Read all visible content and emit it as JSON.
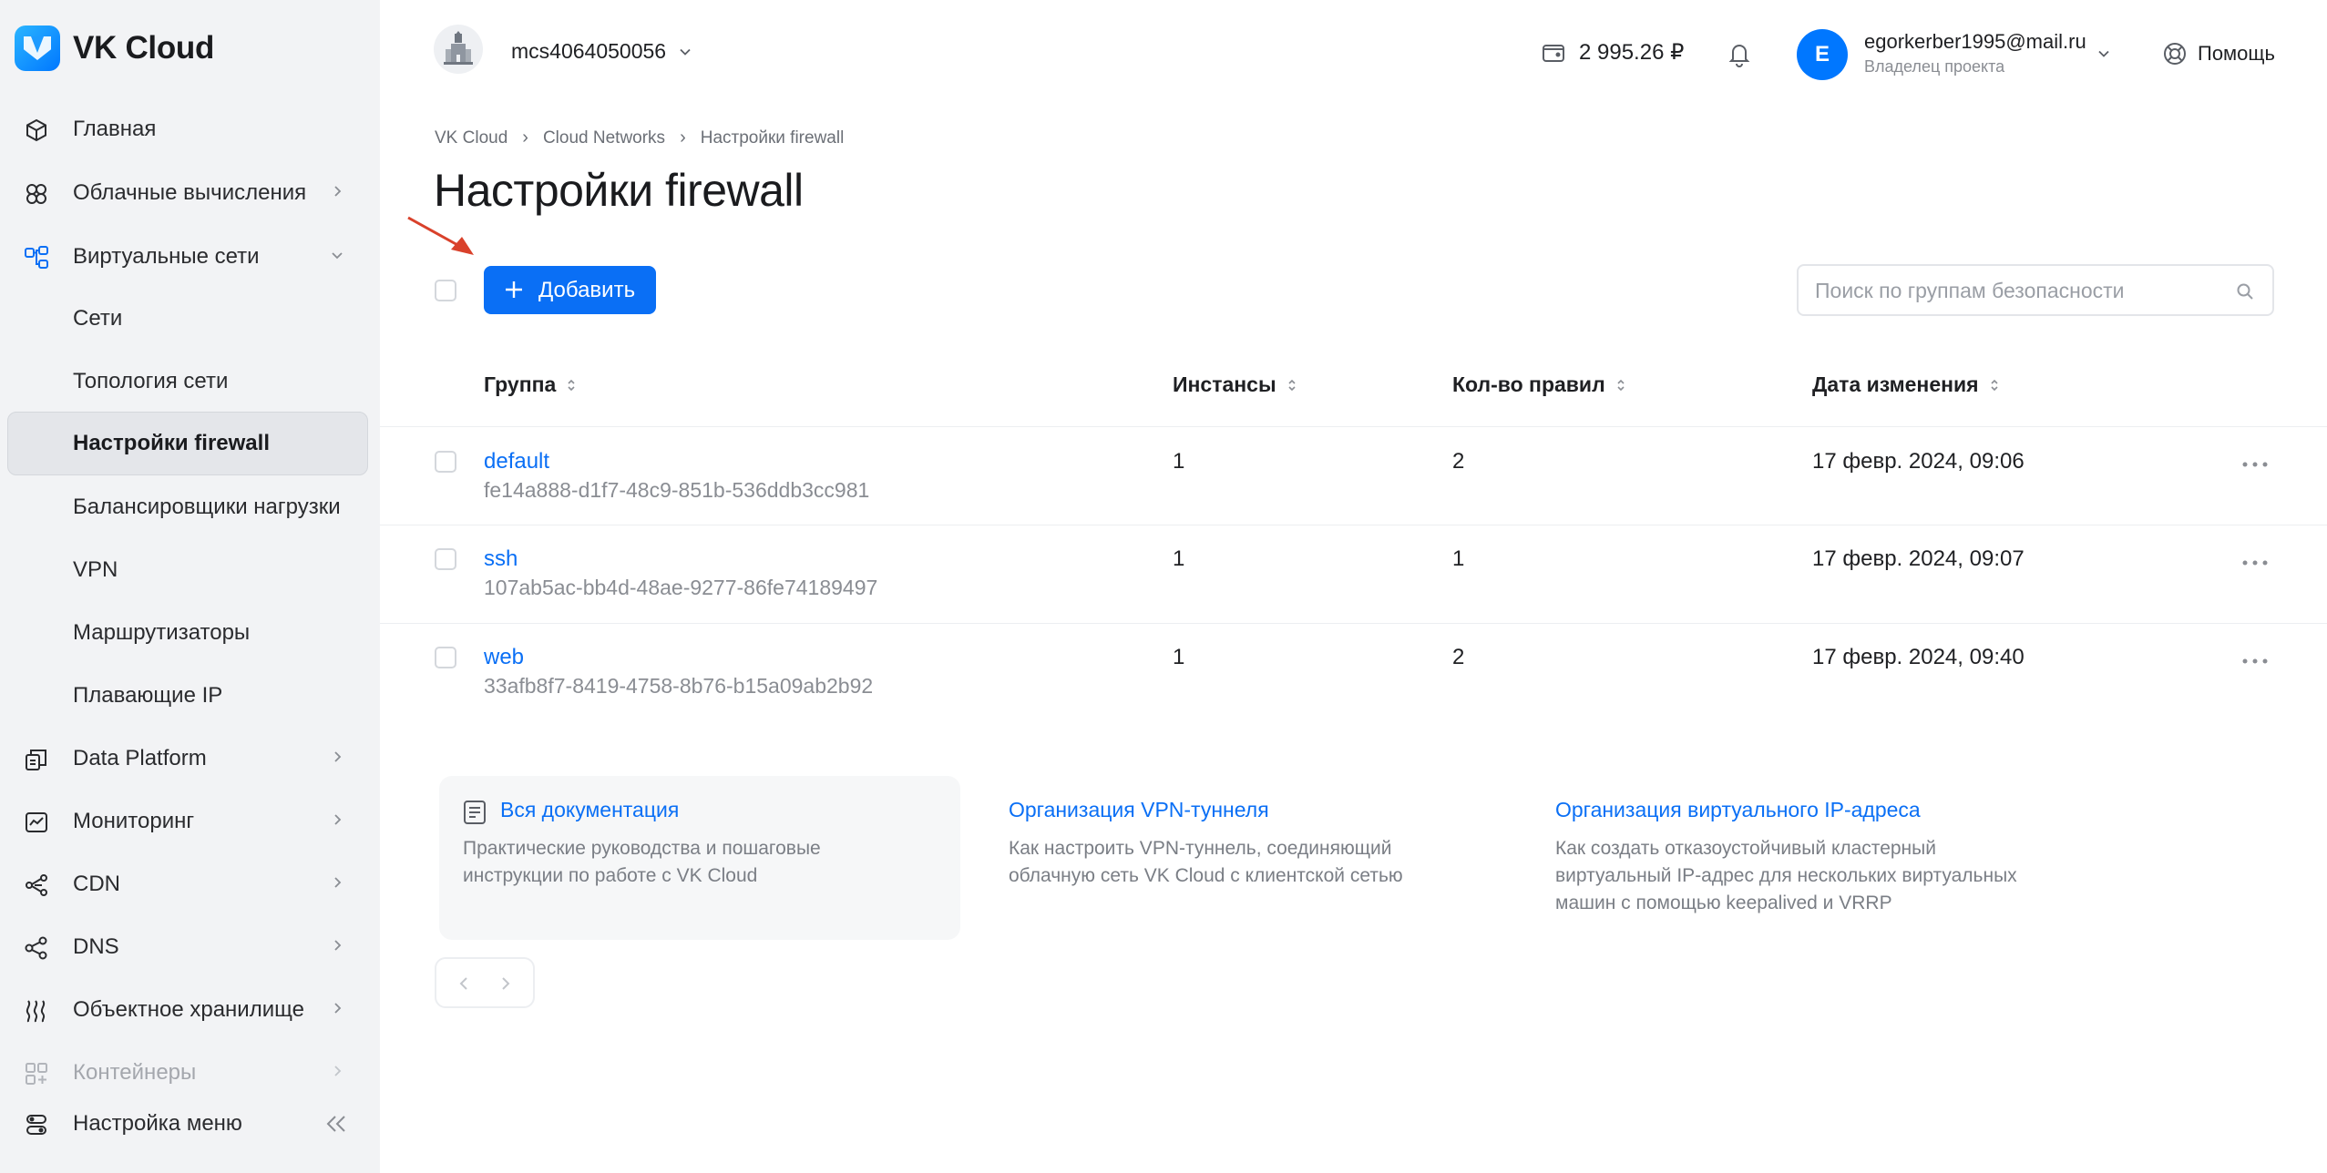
{
  "brand": {
    "name": "VK Cloud"
  },
  "sidebar": {
    "items": [
      {
        "label": "Главная",
        "icon": "cube-icon"
      },
      {
        "label": "Облачные вычисления",
        "icon": "compute-icon"
      },
      {
        "label": "Виртуальные сети",
        "icon": "network-icon",
        "expanded": true
      },
      {
        "label": "Сети"
      },
      {
        "label": "Топология сети"
      },
      {
        "label": "Настройки firewall",
        "active": true
      },
      {
        "label": "Балансировщики нагрузки"
      },
      {
        "label": "VPN"
      },
      {
        "label": "Маршрутизаторы"
      },
      {
        "label": "Плавающие IP"
      },
      {
        "label": "Data Platform",
        "icon": "data-platform-icon"
      },
      {
        "label": "Мониторинг",
        "icon": "monitoring-icon"
      },
      {
        "label": "CDN",
        "icon": "cdn-icon"
      },
      {
        "label": "DNS",
        "icon": "dns-icon"
      },
      {
        "label": "Объектное хранилище",
        "icon": "storage-icon"
      },
      {
        "label": "Контейнеры",
        "icon": "containers-icon"
      }
    ],
    "settings_label": "Настройка меню"
  },
  "topbar": {
    "project": "mcs4064050056",
    "balance": "2 995.26 ₽",
    "user_initial": "E",
    "user_email": "egorkerber1995@mail.ru",
    "user_role": "Владелец проекта",
    "help": "Помощь"
  },
  "breadcrumbs": [
    "VK Cloud",
    "Cloud Networks",
    "Настройки firewall"
  ],
  "page_title": "Настройки firewall",
  "toolbar": {
    "add_label": "Добавить",
    "search_placeholder": "Поиск по группам безопасности"
  },
  "table": {
    "columns": [
      "Группа",
      "Инстансы",
      "Кол-во правил",
      "Дата изменения"
    ],
    "rows": [
      {
        "name": "default",
        "id": "fe14a888-d1f7-48c9-851b-536ddb3cc981",
        "instances": "1",
        "rules": "2",
        "modified": "17 февр. 2024, 09:06"
      },
      {
        "name": "ssh",
        "id": "107ab5ac-bb4d-48ae-9277-86fe74189497",
        "instances": "1",
        "rules": "1",
        "modified": "17 февр. 2024, 09:07"
      },
      {
        "name": "web",
        "id": "33afb8f7-8419-4758-8b76-b15a09ab2b92",
        "instances": "1",
        "rules": "2",
        "modified": "17 февр. 2024, 09:40"
      }
    ]
  },
  "docs": [
    {
      "title": "Вся документация",
      "desc": "Практические руководства и пошаговые инструкции по работе с VK Cloud"
    },
    {
      "title": "Организация VPN-туннеля",
      "desc": "Как настроить VPN-туннель, соединяющий облачную сеть VK Cloud с клиентской сетью"
    },
    {
      "title": "Организация виртуального IP-адреса",
      "desc": "Как создать отказоустойчивый кластерный виртуальный IP-адрес для нескольких виртуальных машин с помощью keepalived и VRRP"
    }
  ],
  "colors": {
    "accent": "#0a6ff5",
    "sidebar_bg": "#f2f3f5",
    "annotation_arrow": "#d9412b"
  }
}
